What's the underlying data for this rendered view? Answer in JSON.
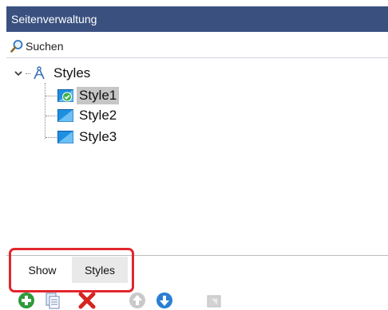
{
  "title": "Seitenverwaltung",
  "search": {
    "label": "Suchen",
    "icon": "search-icon"
  },
  "tree": {
    "root": {
      "label": "Styles",
      "expanded": true,
      "icon": "compass-icon"
    },
    "items": [
      {
        "label": "Style1",
        "selected": true,
        "icon": "style-active-icon"
      },
      {
        "label": "Style2",
        "selected": false,
        "icon": "style-icon"
      },
      {
        "label": "Style3",
        "selected": false,
        "icon": "style-icon"
      }
    ]
  },
  "tabs": [
    {
      "label": "Show",
      "active": false
    },
    {
      "label": "Styles",
      "active": true
    }
  ],
  "toolbar": {
    "buttons": [
      {
        "name": "add-icon",
        "enabled": true
      },
      {
        "name": "copy-icon",
        "enabled": true
      },
      {
        "name": "delete-icon",
        "enabled": true
      },
      {
        "name": "move-up-icon",
        "enabled": false
      },
      {
        "name": "move-down-icon",
        "enabled": true
      },
      {
        "name": "export-icon",
        "enabled": false
      }
    ]
  },
  "colors": {
    "titlebar": "#3a5180",
    "highlight": "#e3262d",
    "selection": "#c6c6c6",
    "tab_active": "#e9e9e9",
    "add_green": "#2f9a3a",
    "delete_red": "#d6251f",
    "move_blue": "#2a7fd3"
  }
}
